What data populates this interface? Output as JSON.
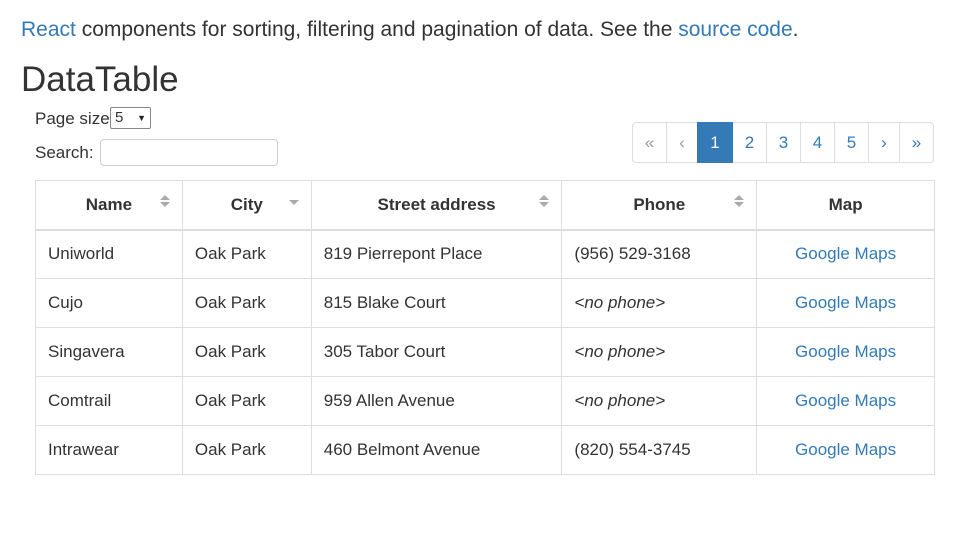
{
  "intro": {
    "react_link": "React",
    "text_middle": " components for sorting, filtering and pagination of data. See the ",
    "source_link": "source code",
    "text_end": "."
  },
  "title": "DataTable",
  "controls": {
    "page_size_label": "Page size:",
    "page_size_value": "5",
    "search_label": "Search:",
    "search_value": ""
  },
  "pagination": {
    "first": "«",
    "prev": "‹",
    "pages": [
      "1",
      "2",
      "3",
      "4",
      "5"
    ],
    "active_page": "1",
    "next": "›",
    "last": "»"
  },
  "table": {
    "columns": [
      {
        "label": "Name",
        "sort": "both"
      },
      {
        "label": "City",
        "sort": "desc"
      },
      {
        "label": "Street address",
        "sort": "both"
      },
      {
        "label": "Phone",
        "sort": "both"
      },
      {
        "label": "Map",
        "sort": "none"
      }
    ],
    "rows": [
      {
        "name": "Uniworld",
        "city": "Oak Park",
        "street": "819 Pierrepont Place",
        "phone": "(956) 529-3168",
        "map": "Google Maps"
      },
      {
        "name": "Cujo",
        "city": "Oak Park",
        "street": "815 Blake Court",
        "phone": "<no phone>",
        "map": "Google Maps"
      },
      {
        "name": "Singavera",
        "city": "Oak Park",
        "street": "305 Tabor Court",
        "phone": "<no phone>",
        "map": "Google Maps"
      },
      {
        "name": "Comtrail",
        "city": "Oak Park",
        "street": "959 Allen Avenue",
        "phone": "<no phone>",
        "map": "Google Maps"
      },
      {
        "name": "Intrawear",
        "city": "Oak Park",
        "street": "460 Belmont Avenue",
        "phone": "(820) 554-3745",
        "map": "Google Maps"
      }
    ]
  },
  "colors": {
    "link": "#337ab7",
    "active_page_bg": "#337ab7",
    "muted_text": "#aaaaaa"
  }
}
